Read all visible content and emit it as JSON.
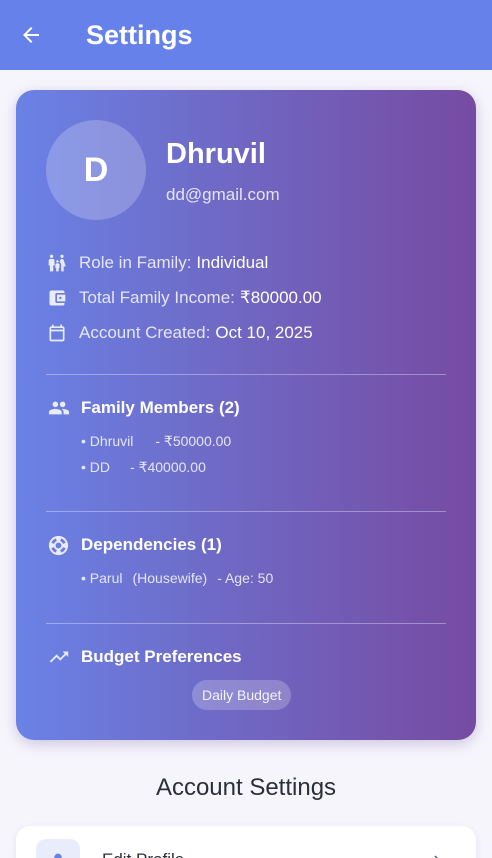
{
  "header": {
    "title": "Settings",
    "back_icon": "arrow-back-icon",
    "background_color": "#6682ea"
  },
  "profile": {
    "initial": "D",
    "name": "Dhruvil",
    "email": "dd@gmail.com",
    "gradient_start": "#6a82e6",
    "gradient_end": "#764ba2"
  },
  "info": [
    {
      "icon": "family-icon",
      "label": "Role in Family:",
      "value": "Individual"
    },
    {
      "icon": "wallet-icon",
      "label": "Total Family Income:",
      "value": "₹80000.00"
    },
    {
      "icon": "calendar-icon",
      "label": "Account Created:",
      "value": "Oct 10, 2025"
    }
  ],
  "family_members": {
    "icon": "people-icon",
    "title": "Family Members (2)",
    "members": [
      {
        "name": "• Dhruvil",
        "amount": "- ₹50000.00"
      },
      {
        "name": "• DD",
        "amount": "- ₹40000.00"
      }
    ]
  },
  "dependencies": {
    "icon": "lifebuoy-icon",
    "title": "Dependencies (1)",
    "items": [
      {
        "name": "• Parul",
        "relation": "(Housewife)",
        "age": "- Age: 50"
      }
    ]
  },
  "budget": {
    "icon": "trending-up-icon",
    "title": "Budget Preferences",
    "chip": "Daily Budget"
  },
  "account_settings": {
    "title": "Account Settings",
    "items": [
      {
        "icon": "person-icon",
        "label": "Edit Profile",
        "chevron": "chevron-right-icon"
      }
    ]
  }
}
